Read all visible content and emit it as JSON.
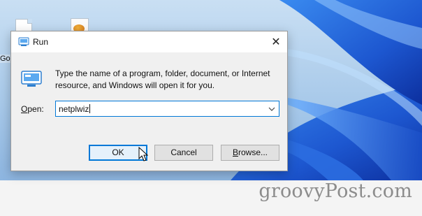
{
  "dialog": {
    "title": "Run",
    "description": "Type the name of a program, folder, document, or Internet resource, and Windows will open it for you.",
    "open_label_prefix": "O",
    "open_label_rest": "pen:",
    "input_value": "netplwiz",
    "buttons": {
      "ok": "OK",
      "cancel": "Cancel",
      "browse_prefix": "B",
      "browse_rest": "rowse..."
    },
    "close_glyph": "✕"
  },
  "desktop": {
    "icon_label": "Go"
  },
  "watermark": "groovyPost.com",
  "colors": {
    "accent": "#0078d7",
    "dialog_bg": "#f0f0f0",
    "wallpaper_blue": "#1f5fd0"
  }
}
